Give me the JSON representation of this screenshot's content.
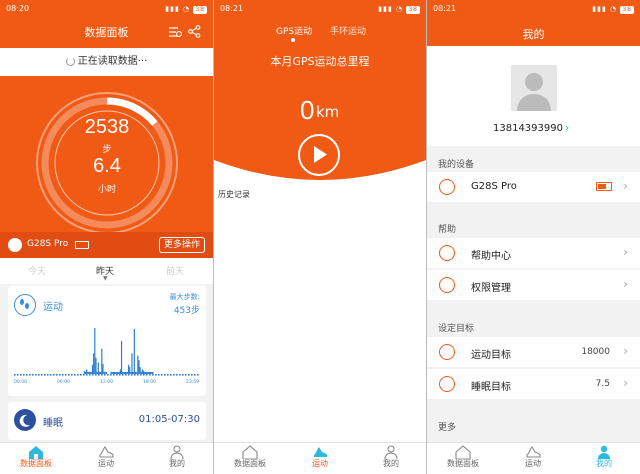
{
  "status_bars": [
    {
      "time": "08:20",
      "battery": "38"
    },
    {
      "time": "08:21",
      "battery": "38"
    },
    {
      "time": "08:21",
      "battery": "38"
    }
  ],
  "dashboard": {
    "title": "数据面板",
    "loading_text": "正在读取数据···",
    "steps": "2538",
    "steps_unit": "步",
    "hours": "6.4",
    "hours_unit": "小时",
    "ring_progress": 0.14,
    "device_name": "G28S Pro",
    "more_button": "更多操作",
    "day_tabs": [
      "今天",
      "昨天",
      "前天"
    ],
    "active_day": 1,
    "activity": {
      "title": "运动",
      "max_steps_label": "最大步数:",
      "max_steps_value": "453步",
      "time_ticks": [
        "00:00",
        "06:00",
        "12:00",
        "18:00",
        "23:59"
      ],
      "bars": [
        0,
        0,
        0,
        0,
        0,
        0,
        0,
        0,
        0,
        0,
        0,
        0,
        0,
        0,
        0,
        0,
        0,
        0,
        0,
        0,
        0,
        0,
        0,
        0,
        0,
        0,
        0,
        0,
        0,
        0,
        0,
        0,
        0,
        0,
        0,
        0,
        0,
        0,
        0,
        0,
        0,
        0,
        0,
        0,
        0,
        0,
        0,
        0,
        0,
        0,
        0,
        0,
        0,
        0,
        0,
        0,
        0,
        0,
        0,
        0,
        0.06,
        0.04,
        0.1,
        0.03,
        0.05,
        0.02,
        0.04,
        0.2,
        0.45,
        1.0,
        0.35,
        0.03,
        0.25,
        0.05,
        0.02,
        0.55,
        0.22,
        0.03,
        0.05,
        0.02,
        0,
        0,
        0,
        0.05,
        0.02,
        0.03,
        0.04,
        0.03,
        0.02,
        0.02,
        0.04,
        0.1,
        0.72,
        0.03,
        0.02,
        0.02,
        0.04,
        0.03,
        0.2,
        0.15,
        0.03,
        0.45,
        0.02,
        0.98,
        0.02,
        0.04,
        0.4,
        0.3,
        0.15,
        0.05,
        0.1,
        0.07,
        0.04,
        0.03,
        0.03,
        0.02,
        0.03,
        0.02,
        0.02,
        0.02,
        0,
        0,
        0,
        0,
        0,
        0,
        0,
        0,
        0,
        0,
        0,
        0,
        0,
        0,
        0,
        0,
        0,
        0,
        0,
        0,
        0,
        0,
        0,
        0,
        0,
        0,
        0,
        0,
        0,
        0,
        0,
        0,
        0,
        0,
        0,
        0,
        0,
        0,
        0,
        0
      ]
    },
    "sleep": {
      "title": "睡眠",
      "time_range": "01:05-07:30"
    }
  },
  "sport": {
    "tabs": [
      "GPS运动",
      "手环运动"
    ],
    "active_tab": 0,
    "headline": "本月GPS运动总里程",
    "distance_value": "0",
    "distance_unit": "km",
    "history_label": "历史记录"
  },
  "mine": {
    "title": "我的",
    "phone": "13814393990",
    "sections": {
      "devices": "我的设备",
      "help": "帮助",
      "goals": "设定目标",
      "more": "更多"
    },
    "device_row": {
      "label": "G28S Pro"
    },
    "help_rows": [
      {
        "label": "帮助中心"
      },
      {
        "label": "权限管理"
      }
    ],
    "goal_rows": [
      {
        "label": "运动目标",
        "value": "18000"
      },
      {
        "label": "睡眠目标",
        "value": "7.5"
      }
    ]
  },
  "nav": {
    "items": [
      {
        "label": "数据面板"
      },
      {
        "label": "运动"
      },
      {
        "label": "我的"
      }
    ]
  },
  "colors": {
    "brand": "#f05a14",
    "activity_blue": "#2e7fd1",
    "active_cyan": "#2bb9e0"
  }
}
